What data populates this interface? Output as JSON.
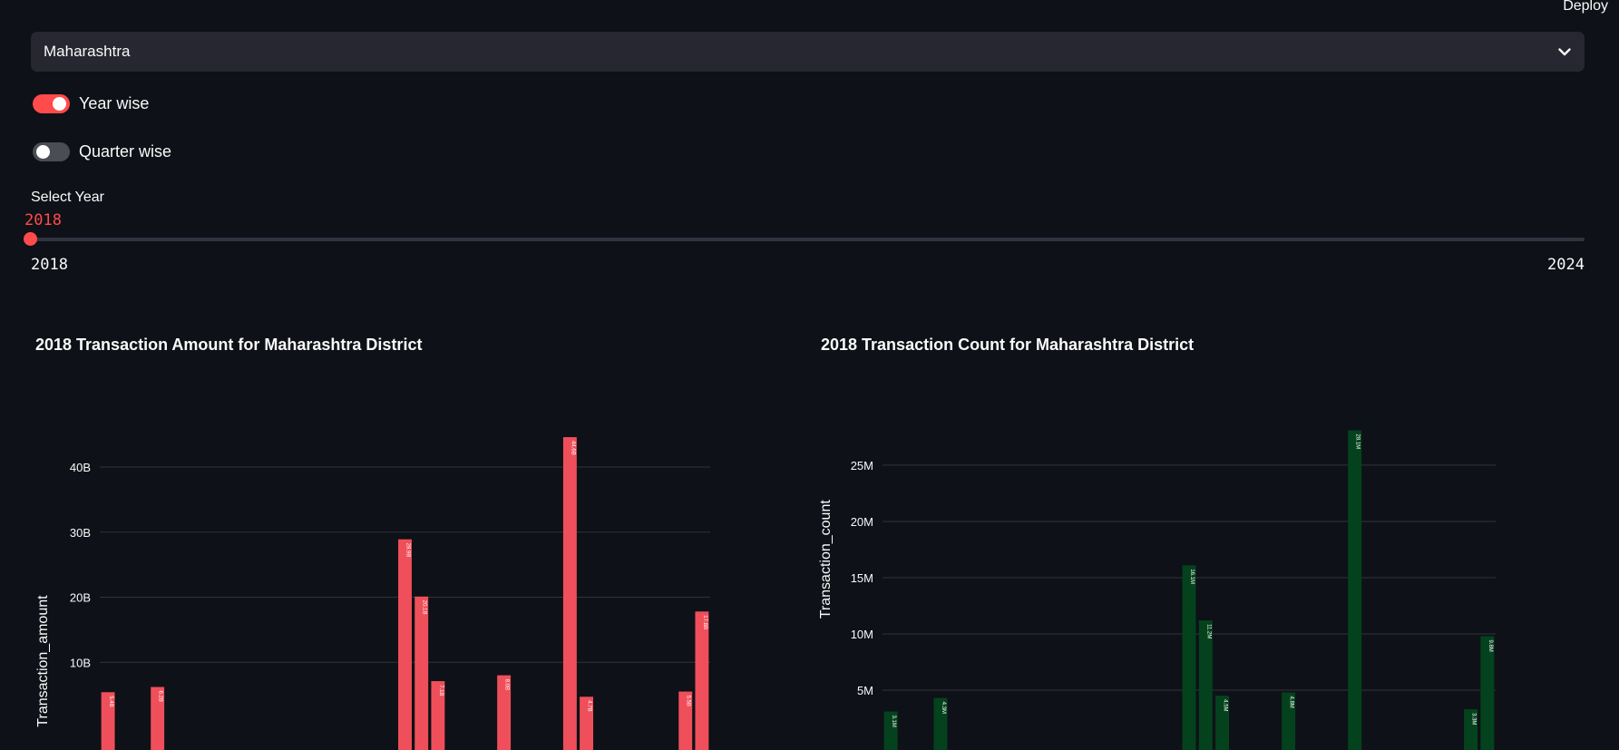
{
  "header": {
    "deploy_label": "Deploy"
  },
  "state_select": {
    "value": "Maharashtra",
    "icon": "chevron-down-icon"
  },
  "toggles": {
    "year_wise": {
      "label": "Year wise",
      "on": true
    },
    "quarter_wise": {
      "label": "Quarter wise",
      "on": false
    }
  },
  "year_slider": {
    "label": "Select Year",
    "current": "2018",
    "min": "2018",
    "max": "2024",
    "fraction": 0
  },
  "colors": {
    "accent": "#ff4b4b",
    "amount_bar": "#ef4f5a",
    "count_bar": "#04421d",
    "background": "#0e1117"
  },
  "charts": {
    "amount": {
      "title": "2018 Transaction Amount for Maharashtra District"
    },
    "count": {
      "title": "2018 Transaction Count for Maharashtra District"
    }
  },
  "chart_data": [
    {
      "type": "bar",
      "ylabel": "Transaction_amount",
      "ylim": [
        0,
        46
      ],
      "unit": "B",
      "yticks": [
        10,
        20,
        30,
        40
      ],
      "ytick_labels": [
        "10B",
        "20B",
        "30B",
        "40B"
      ],
      "values": [
        5.4,
        0,
        0,
        6.2,
        0,
        0,
        0,
        0,
        0,
        0,
        0,
        0,
        0,
        0,
        0,
        0,
        0,
        0,
        28.9,
        20.1,
        7.1,
        0,
        0,
        0,
        8.0,
        0,
        0,
        0,
        44.6,
        4.7,
        0,
        0,
        0,
        0,
        0,
        5.5,
        17.8
      ],
      "data_labels": [
        "5.4B",
        "",
        "",
        "6.2B",
        "",
        "",
        "",
        "",
        "",
        "",
        "",
        "",
        "",
        "",
        "",
        "",
        "",
        "",
        "28.9B",
        "20.1B",
        "7.1B",
        "",
        "",
        "",
        "8.0B",
        "",
        "",
        "",
        "44.6B",
        "4.7B",
        "",
        "",
        "",
        "",
        "",
        "5.5B",
        "17.8B"
      ],
      "grid": true
    },
    {
      "type": "bar",
      "ylabel": "Transaction_count",
      "ylim": [
        0,
        28.3
      ],
      "unit": "M",
      "yticks": [
        5,
        10,
        15,
        20,
        25
      ],
      "ytick_labels": [
        "5M",
        "10M",
        "15M",
        "20M",
        "25M"
      ],
      "values": [
        3.1,
        0,
        0,
        4.3,
        0,
        0,
        0,
        0,
        0,
        0,
        0,
        0,
        0,
        0,
        0,
        0,
        0,
        0,
        16.1,
        11.2,
        4.5,
        0,
        0,
        0,
        4.8,
        0,
        0,
        0,
        28.1,
        0,
        0,
        0,
        0,
        0,
        0,
        3.3,
        9.8
      ],
      "data_labels": [
        "3.1M",
        "",
        "",
        "4.3M",
        "",
        "",
        "",
        "",
        "",
        "",
        "",
        "",
        "",
        "",
        "",
        "",
        "",
        "",
        "16.1M",
        "11.2M",
        "4.5M",
        "",
        "",
        "",
        "4.8M",
        "",
        "",
        "",
        "28.1M",
        "",
        "",
        "",
        "",
        "",
        "",
        "3.3M",
        "9.8M"
      ],
      "grid": true
    }
  ]
}
